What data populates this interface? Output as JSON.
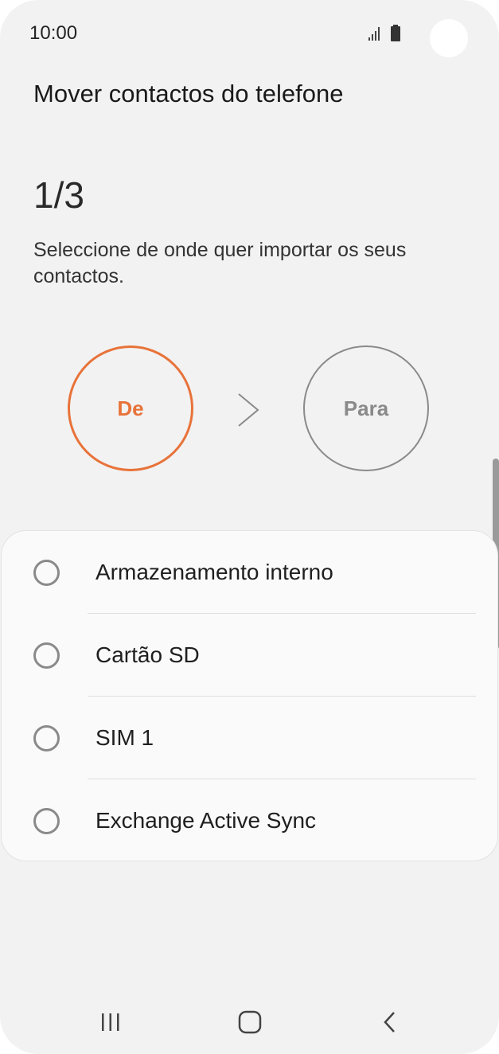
{
  "status_bar": {
    "time": "10:00",
    "icons": [
      "signal-icon",
      "battery-icon"
    ]
  },
  "header": {
    "title": "Mover contactos do telefone"
  },
  "step": {
    "counter": "1/3",
    "instructions": "Seleccione de onde quer importar os seus contactos.",
    "from_label": "De",
    "to_label": "Para",
    "active_color": "#e8733a",
    "inactive_color": "#8a8a8a"
  },
  "options": {
    "items": [
      {
        "label": "Armazenamento interno"
      },
      {
        "label": "Cartão SD"
      },
      {
        "label": "SIM 1"
      },
      {
        "label": "Exchange Active Sync"
      }
    ]
  },
  "nav_bar": {
    "icons": [
      "recents-icon",
      "home-icon",
      "back-icon"
    ]
  }
}
